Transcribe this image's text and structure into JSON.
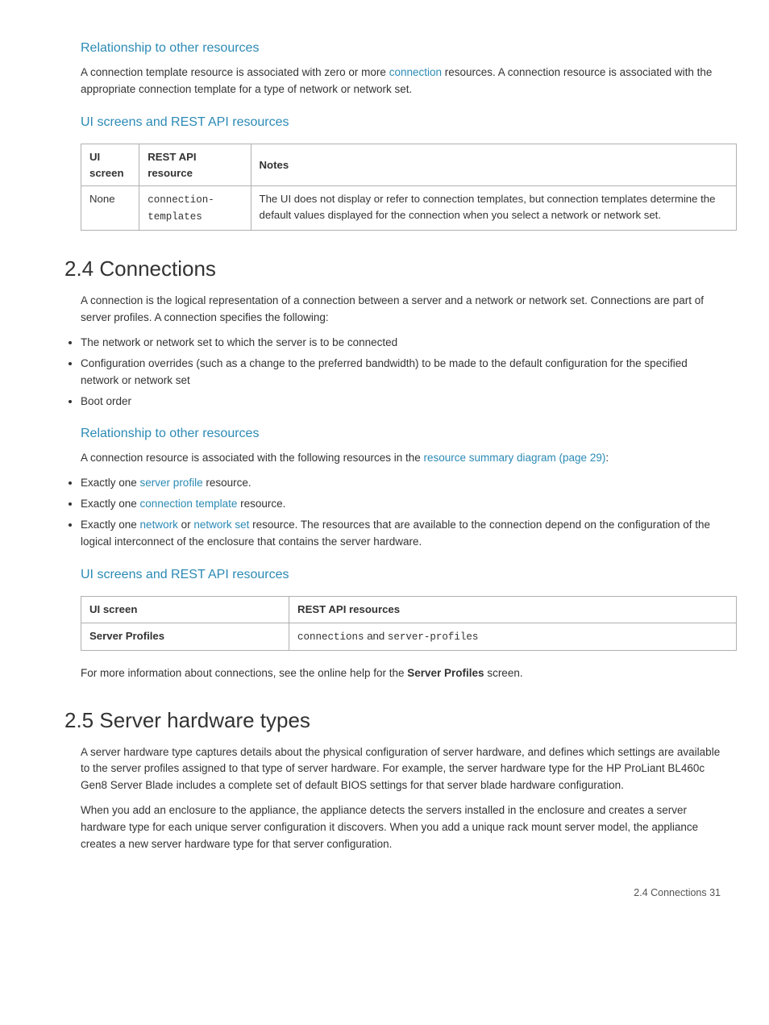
{
  "page": {
    "footer": "2.4 Connections    31"
  },
  "section_relationship_top": {
    "heading": "Relationship to other resources",
    "paragraph": "A connection template resource is associated with zero or more ",
    "link_connection": "connection",
    "paragraph2": " resources. A connection resource is associated with the appropriate connection template for a type of network or network set."
  },
  "section_ui_screens_top": {
    "heading": "UI screens and REST API resources",
    "table": {
      "headers": [
        "UI screen",
        "REST API resource",
        "Notes"
      ],
      "rows": [
        {
          "ui_screen": "None",
          "rest_api": "connection-templates",
          "notes": "The UI does not display or refer to connection templates, but connection templates determine the default values displayed for the connection when you select a network or network set."
        }
      ]
    }
  },
  "section_24": {
    "heading": "2.4 Connections",
    "paragraph": "A connection is the logical representation of a connection between a server and a network or network set. Connections are part of server profiles. A connection specifies the following:",
    "bullets": [
      "The network or network set to which the server is to be connected",
      "Configuration overrides (such as a change to the preferred bandwidth) to be made to the default configuration for the specified network or network set",
      "Boot order"
    ]
  },
  "section_relationship_24": {
    "heading": "Relationship to other resources",
    "paragraph_start": "A connection resource is associated with the following resources in the ",
    "link_diagram": "resource summary diagram (page 29)",
    "paragraph_end": ":",
    "bullets": [
      {
        "prefix": "Exactly one ",
        "link": "server profile",
        "suffix": " resource."
      },
      {
        "prefix": "Exactly one ",
        "link": "connection template",
        "suffix": " resource."
      },
      {
        "prefix": "Exactly one ",
        "link1": "network",
        "middle": " or ",
        "link2": "network set",
        "suffix": " resource. The resources that are available to the connection depend on the configuration of the logical interconnect of the enclosure that contains the server hardware."
      }
    ]
  },
  "section_ui_screens_24": {
    "heading": "UI screens and REST API resources",
    "table": {
      "headers": [
        "UI screen",
        "REST API resources"
      ],
      "rows": [
        {
          "ui_screen": "Server Profiles",
          "rest_api_plain": "connections and ",
          "rest_api_link": "server-profiles"
        }
      ]
    },
    "footer_text_start": "For more information about connections, see the online help for the ",
    "footer_bold": "Server Profiles",
    "footer_text_end": " screen."
  },
  "section_25": {
    "heading": "2.5 Server hardware types",
    "paragraph1": "A server hardware type captures details about the physical configuration of server hardware, and defines which settings are available to the server profiles assigned to that type of server hardware. For example, the server hardware type for the HP ProLiant BL460c Gen8 Server Blade includes a complete set of default BIOS settings for that server blade hardware configuration.",
    "paragraph2": "When you add an enclosure to the appliance, the appliance detects the servers installed in the enclosure and creates a server hardware type for each unique server configuration it discovers. When you add a unique rack mount server model, the appliance creates a new server hardware type for that server configuration."
  }
}
